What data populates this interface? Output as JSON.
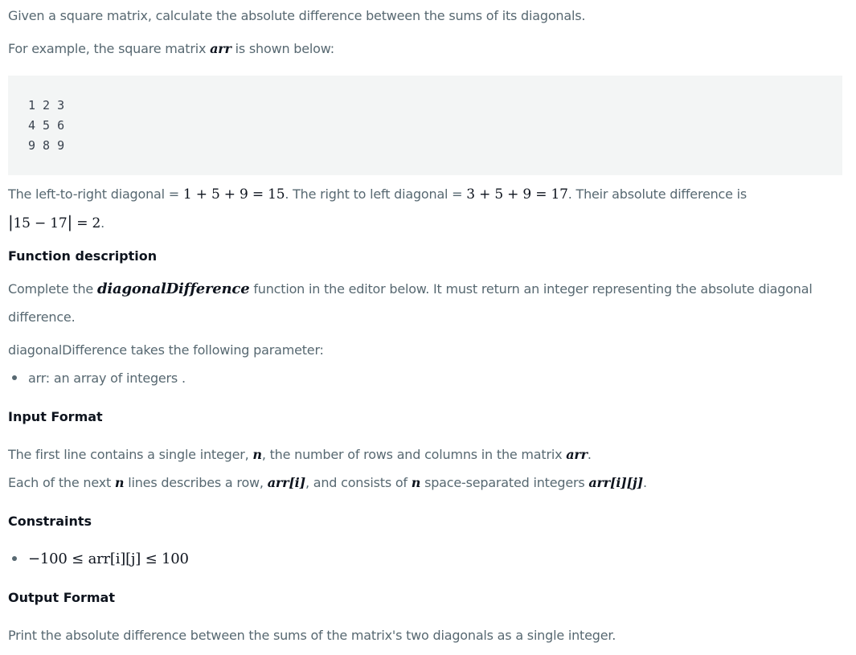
{
  "intro": {
    "line1": "Given a square matrix, calculate the absolute difference between the sums of its diagonals.",
    "line2_prefix": "For example, the square matrix ",
    "line2_var": "arr",
    "line2_suffix": " is shown below:"
  },
  "matrix_example": [
    "1 2 3",
    "4 5 6",
    "9 8 9"
  ],
  "explanation": {
    "ltr_label": "The left-to-right diagonal = ",
    "ltr_math": "1 + 5 + 9 = 15",
    "rtl_label": ". The right to left diagonal = ",
    "rtl_math": "3 + 5 + 9 = 17",
    "tail": ". Their absolute difference is",
    "abs_math": "15 − 17",
    "abs_result": " = 2",
    "period": "."
  },
  "function_description": {
    "heading": "Function description",
    "line1_prefix": "Complete the ",
    "function_name": "diagonalDifference",
    "line1_suffix": " function in the editor below. It must return an integer representing the absolute diagonal",
    "line2": "difference.",
    "params_intro": "diagonalDifference takes the following parameter:",
    "param_item": "arr: an array of integers ."
  },
  "input_format": {
    "heading": "Input Format",
    "line1_prefix": "The first line contains a single integer, ",
    "line1_var": "n",
    "line1_mid": ", the number of rows and columns in the matrix ",
    "line1_var2": "arr",
    "line1_end": ".",
    "line2_prefix": "Each of the next ",
    "line2_var": "n",
    "line2_mid": " lines describes a row, ",
    "line2_arr": "arr[i]",
    "line2_mid2": ", and consists of ",
    "line2_var2": "n",
    "line2_mid3": " space-separated integers ",
    "line2_arr2": "arr[i][j]",
    "line2_end": "."
  },
  "constraints": {
    "heading": "Constraints",
    "item": "−100 ≤ arr[i][j] ≤ 100"
  },
  "output_format": {
    "heading": "Output Format",
    "line1": "Print the absolute difference between the sums of the matrix's two diagonals as a single integer."
  }
}
